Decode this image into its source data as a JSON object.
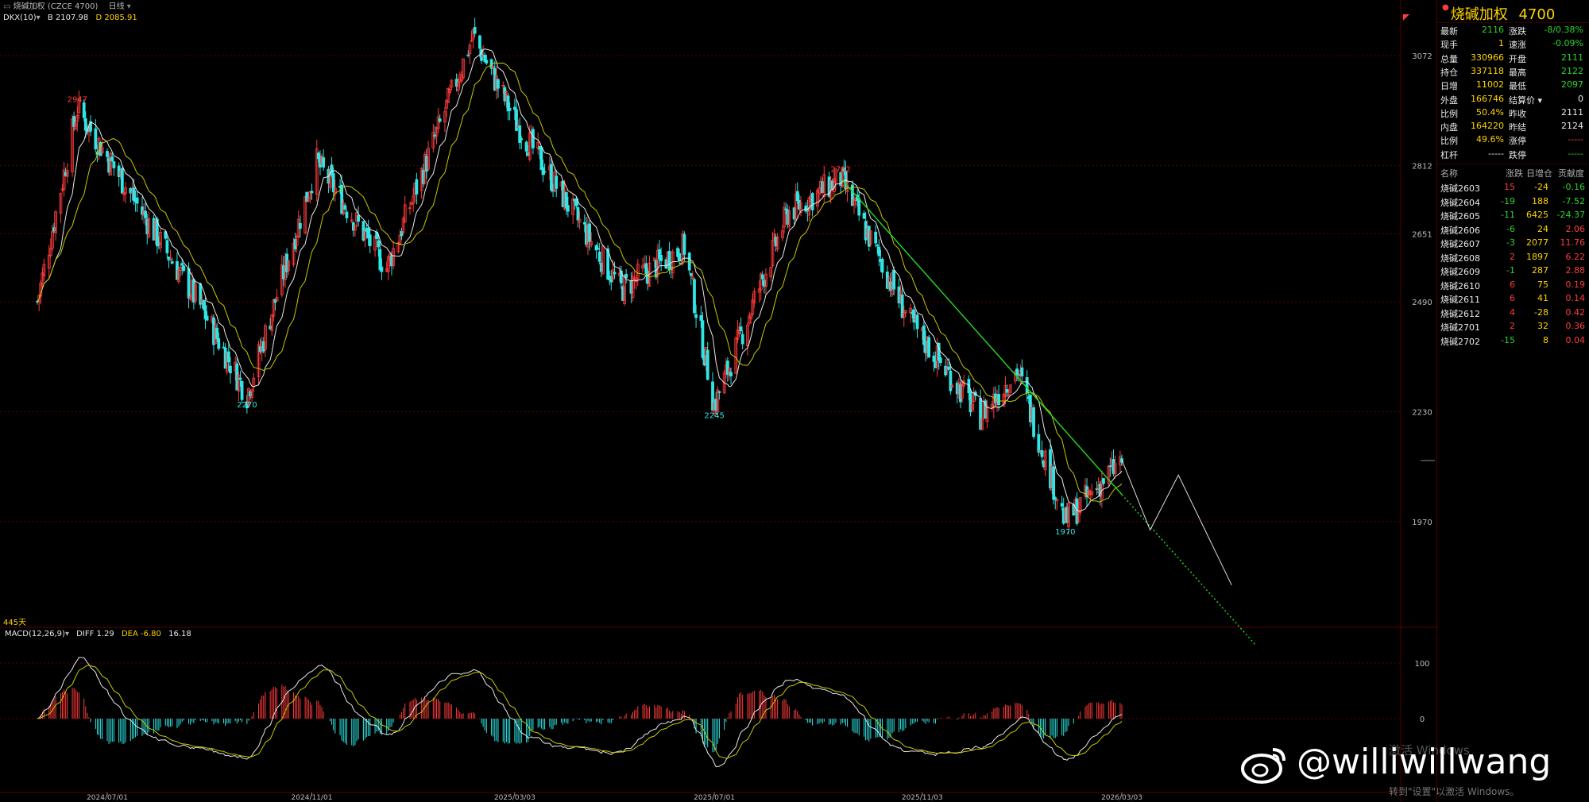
{
  "header": {
    "instrument": "烧碱加权 (CZCE 4700)",
    "period": "日线"
  },
  "indicator_dkx": {
    "label": "DKX(10)",
    "b_label": "B",
    "b_value": "2107.98",
    "d_label": "D",
    "d_value": "2085.91"
  },
  "price_axis": {
    "ticks": [
      "3072",
      "2812",
      "2651",
      "2490",
      "2230",
      "1970"
    ]
  },
  "annotations": {
    "high_2947": "2947",
    "low_2270": "2270",
    "low_2245": "2245",
    "high_2782": "2782",
    "low_1970": "1970",
    "volume_label": "445天"
  },
  "macd": {
    "label": "MACD(12,26,9)",
    "diff_label": "DIFF",
    "diff_value": "1.29",
    "dea_label": "DEA",
    "dea_value": "-6.80",
    "macd_value": "16.18",
    "axis_ticks": [
      "100",
      "0"
    ]
  },
  "date_axis": [
    "2024/07/01",
    "2024/11/01",
    "2025/03/03",
    "2025/07/01",
    "2025/11/03",
    "2026/03/03"
  ],
  "quote_panel": {
    "title": "烧碱加权",
    "code": "4700",
    "rows": [
      {
        "l1": "最新",
        "v1": "2116",
        "c1": "green",
        "l2": "涨跌",
        "v2": "-8/0.38%",
        "c2": "green"
      },
      {
        "l1": "现手",
        "v1": "1",
        "c1": "yellow",
        "l2": "速涨",
        "v2": "-0.09%",
        "c2": "green"
      },
      {
        "l1": "总量",
        "v1": "330966",
        "c1": "yellow",
        "l2": "开盘",
        "v2": "2111",
        "c2": "green"
      },
      {
        "l1": "持仓",
        "v1": "337118",
        "c1": "yellow",
        "l2": "最高",
        "v2": "2122",
        "c2": "green"
      },
      {
        "l1": "日增",
        "v1": "11002",
        "c1": "yellow",
        "l2": "最低",
        "v2": "2097",
        "c2": "green"
      },
      {
        "l1": "外盘",
        "v1": "166746",
        "c1": "yellow",
        "l2": "结算价 ▾",
        "v2": "0",
        "c2": "white"
      },
      {
        "l1": "比例",
        "v1": "50.4%",
        "c1": "yellow",
        "l2": "昨收",
        "v2": "2111",
        "c2": "white"
      },
      {
        "l1": "内盘",
        "v1": "164220",
        "c1": "yellow",
        "l2": "昨结",
        "v2": "2124",
        "c2": "white"
      },
      {
        "l1": "比例",
        "v1": "49.6%",
        "c1": "yellow",
        "l2": "涨停",
        "v2": "-----",
        "c2": "red"
      },
      {
        "l1": "杠杆",
        "v1": "-----",
        "c1": "white",
        "l2": "跌停",
        "v2": "-----",
        "c2": "green"
      }
    ]
  },
  "contracts": {
    "headers": [
      "名称",
      "涨跌",
      "日增仓",
      "贡献度"
    ],
    "rows": [
      {
        "name": "烧碱2603",
        "chg": "15",
        "chg_c": "red",
        "oi": "-24",
        "contrib": "-0.16",
        "contrib_c": "green"
      },
      {
        "name": "烧碱2604",
        "chg": "-19",
        "chg_c": "green",
        "oi": "188",
        "contrib": "-7.52",
        "contrib_c": "green"
      },
      {
        "name": "烧碱2605",
        "chg": "-11",
        "chg_c": "green",
        "oi": "6425",
        "contrib": "-24.37",
        "contrib_c": "green"
      },
      {
        "name": "烧碱2606",
        "chg": "-6",
        "chg_c": "green",
        "oi": "24",
        "contrib": "2.06",
        "contrib_c": "red"
      },
      {
        "name": "烧碱2607",
        "chg": "-3",
        "chg_c": "green",
        "oi": "2077",
        "contrib": "11.76",
        "contrib_c": "red"
      },
      {
        "name": "烧碱2608",
        "chg": "2",
        "chg_c": "red",
        "oi": "1897",
        "contrib": "6.22",
        "contrib_c": "red"
      },
      {
        "name": "烧碱2609",
        "chg": "-1",
        "chg_c": "green",
        "oi": "287",
        "contrib": "2.88",
        "contrib_c": "red"
      },
      {
        "name": "烧碱2610",
        "chg": "6",
        "chg_c": "red",
        "oi": "75",
        "contrib": "0.19",
        "contrib_c": "red"
      },
      {
        "name": "烧碱2611",
        "chg": "6",
        "chg_c": "red",
        "oi": "41",
        "contrib": "0.14",
        "contrib_c": "red"
      },
      {
        "name": "烧碱2612",
        "chg": "4",
        "chg_c": "red",
        "oi": "-28",
        "contrib": "0.42",
        "contrib_c": "red"
      },
      {
        "name": "烧碱2701",
        "chg": "2",
        "chg_c": "red",
        "oi": "32",
        "contrib": "0.36",
        "contrib_c": "red"
      },
      {
        "name": "烧碱2702",
        "chg": "-15",
        "chg_c": "green",
        "oi": "8",
        "contrib": "0.04",
        "contrib_c": "red"
      }
    ]
  },
  "watermark": {
    "handle": "@williwillwang",
    "activate_line1": "激活 Windows",
    "activate_line2": "转到\"设置\"以激活 Windows。"
  },
  "colors": {
    "up": "#ff3b3b",
    "down": "#2ee6e6",
    "ma_white": "#e8e8e8",
    "ma_yellow": "#c8c800",
    "trend": "#22dd22",
    "grid": "#5a0000"
  },
  "chart_data": {
    "type": "candlestick",
    "price_anchors": [
      {
        "date": "2024/05/20",
        "price": 2490
      },
      {
        "date": "2024/06/13",
        "price": 2947
      },
      {
        "date": "2024/08/26",
        "price": 2480
      },
      {
        "date": "2024/09/23",
        "price": 2270
      },
      {
        "date": "2024/11/04",
        "price": 2820
      },
      {
        "date": "2024/12/16",
        "price": 2570
      },
      {
        "date": "2025/02/06",
        "price": 3120
      },
      {
        "date": "2025/03/03",
        "price": 2920
      },
      {
        "date": "2025/05/06",
        "price": 2520
      },
      {
        "date": "2025/06/13",
        "price": 2620
      },
      {
        "date": "2025/07/01",
        "price": 2245
      },
      {
        "date": "2025/08/14",
        "price": 2700
      },
      {
        "date": "2025/09/15",
        "price": 2782
      },
      {
        "date": "2025/10/27",
        "price": 2440
      },
      {
        "date": "2025/12/08",
        "price": 2220
      },
      {
        "date": "2025/12/30",
        "price": 2330
      },
      {
        "date": "2026/01/28",
        "price": 1970
      },
      {
        "date": "2026/03/03",
        "price": 2116
      }
    ],
    "projection": [
      {
        "date": "2026/03/03",
        "price": 2116
      },
      {
        "date": "2026/03/20",
        "price": 1950
      },
      {
        "date": "2026/04/06",
        "price": 2080
      },
      {
        "date": "2026/05/08",
        "price": 1820
      }
    ],
    "trendline": [
      {
        "date": "2025/09/15",
        "price": 2782
      },
      {
        "date": "2026/05/22",
        "price": 1680
      }
    ],
    "ylim": [
      1720,
      3170
    ]
  }
}
